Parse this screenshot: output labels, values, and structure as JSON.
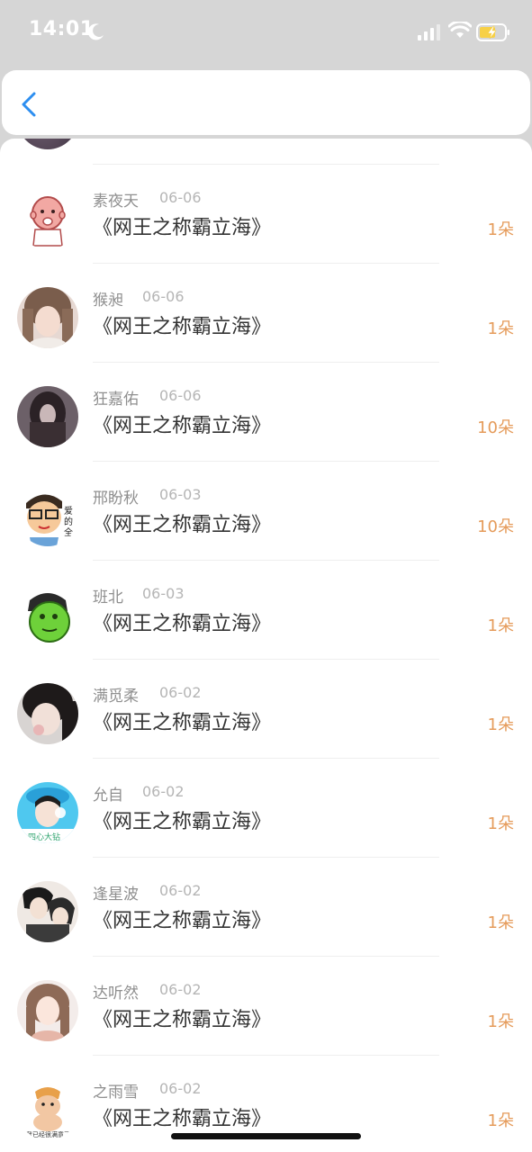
{
  "status_bar": {
    "time": "14:01"
  },
  "icons": {
    "moon": "moon-icon",
    "signal": "signal-icon",
    "wifi": "wifi-icon",
    "battery": "battery-charging-icon",
    "back": "chevron-left-icon"
  },
  "colors": {
    "accent_blue": "#2d8ef0",
    "flower_orange": "#e59b5a",
    "name_gray": "#8f8f8f",
    "date_gray": "#b5b5b5",
    "title_dark": "#333333",
    "battery_yellow": "#f7d046"
  },
  "items": [
    {
      "name": "素夜天",
      "date": "06-06",
      "title": "《网王之称霸立海》",
      "count": "1朵",
      "avatar": "baby-avatar"
    },
    {
      "name": "猴昶",
      "date": "06-06",
      "title": "《网王之称霸立海》",
      "count": "1朵",
      "avatar": "girl-photo-avatar"
    },
    {
      "name": "狂嘉佑",
      "date": "06-06",
      "title": "《网王之称霸立海》",
      "count": "10朵",
      "avatar": "dark-hair-avatar"
    },
    {
      "name": "邢盼秋",
      "date": "06-03",
      "title": "《网王之称霸立海》",
      "count": "10朵",
      "avatar": "cartoon-glasses-avatar"
    },
    {
      "name": "班北",
      "date": "06-03",
      "title": "《网王之称霸立海》",
      "count": "1朵",
      "avatar": "green-hulk-avatar"
    },
    {
      "name": "满觅柔",
      "date": "06-02",
      "title": "《网王之称霸立海》",
      "count": "1朵",
      "avatar": "girl-dark-avatar"
    },
    {
      "name": "允自",
      "date": "06-02",
      "title": "《网王之称霸立海》",
      "count": "1朵",
      "avatar": "blue-hat-avatar"
    },
    {
      "name": "逢星波",
      "date": "06-02",
      "title": "《网王之称霸立海》",
      "count": "1朵",
      "avatar": "anime-boys-avatar"
    },
    {
      "name": "达听然",
      "date": "06-02",
      "title": "《网王之称霸立海》",
      "count": "1朵",
      "avatar": "illustrated-girl-avatar"
    },
    {
      "name": "之雨雪",
      "date": "06-02",
      "title": "《网王之称霸立海》",
      "count": "1朵",
      "avatar": "cartoon-man-avatar"
    }
  ]
}
